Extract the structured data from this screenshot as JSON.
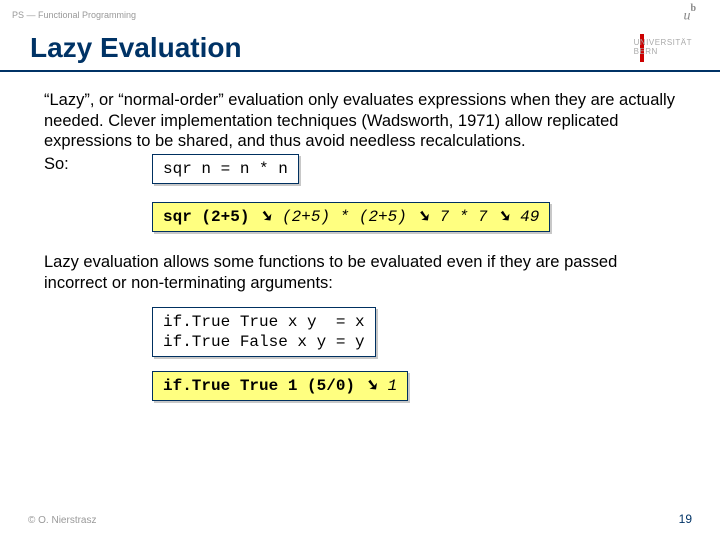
{
  "breadcrumb": "PS — Functional Programming",
  "logo": {
    "u": "u",
    "b": "b",
    "uni1": "UNIVERSITÄT",
    "uni2": "BERN"
  },
  "title": "Lazy Evaluation",
  "para1": "“Lazy”, or “normal-order” evaluation only evaluates expressions when they are actually needed. Clever implementation techniques (Wadsworth, 1971) allow replicated expressions to be shared, and thus avoid needless recalculations.",
  "so": "So:",
  "code1": "sqr n = n * n",
  "eval1": {
    "a": "sqr (2+5)",
    "arr1": "➘",
    "b": "(2+5) * (2+5)",
    "arr2": "➘",
    "c": "7 * 7",
    "arr3": "➘",
    "d": "49"
  },
  "para2": "Lazy evaluation allows some functions to be evaluated even if they are passed incorrect or non-terminating arguments:",
  "code2": "if.True True x y  = x\nif.True False x y = y",
  "eval2": {
    "a": "if.True True 1 (5/0)",
    "arr": "➘",
    "b": "1"
  },
  "footer": {
    "left": "© O. Nierstrasz",
    "right": "19"
  }
}
